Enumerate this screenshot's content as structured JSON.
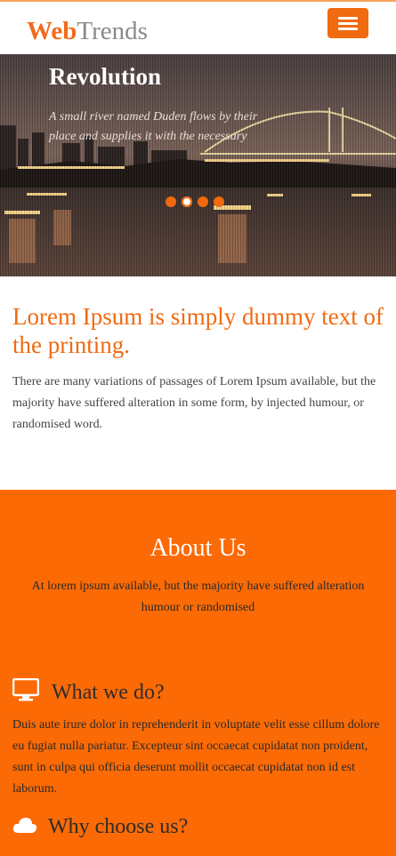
{
  "brand": {
    "part1": "Web",
    "part2": "Trends"
  },
  "menu": {
    "icon": "hamburger-icon"
  },
  "hero": {
    "title": "Revolution",
    "subtitle": "A small river named Duden flows by their place and supplies it with the necessary",
    "slides_count": 4,
    "active_slide": 2
  },
  "intro": {
    "heading": "Lorem Ipsum is simply dummy text of the printing.",
    "body": "There are many variations of passages of Lorem Ipsum available, but the majority have suffered alteration in some form, by injected humour, or randomised word."
  },
  "about": {
    "title": "About Us",
    "lead": "At lorem ipsum available, but the majority have suffered alteration humour or randomised",
    "features": [
      {
        "icon": "monitor-icon",
        "title": "What we do?",
        "body": "Duis aute irure dolor in reprehenderit in voluptate velit esse cillum dolore eu fugiat nulla pariatur. Excepteur sint occaecat cupidatat non proident, sunt in culpa qui officia deserunt mollit occaecat cupidatat non id est laborum."
      },
      {
        "icon": "cloud-icon",
        "title": "Why choose us?"
      }
    ]
  },
  "colors": {
    "accent": "#f06a10",
    "section_bg": "#fb6a05"
  }
}
